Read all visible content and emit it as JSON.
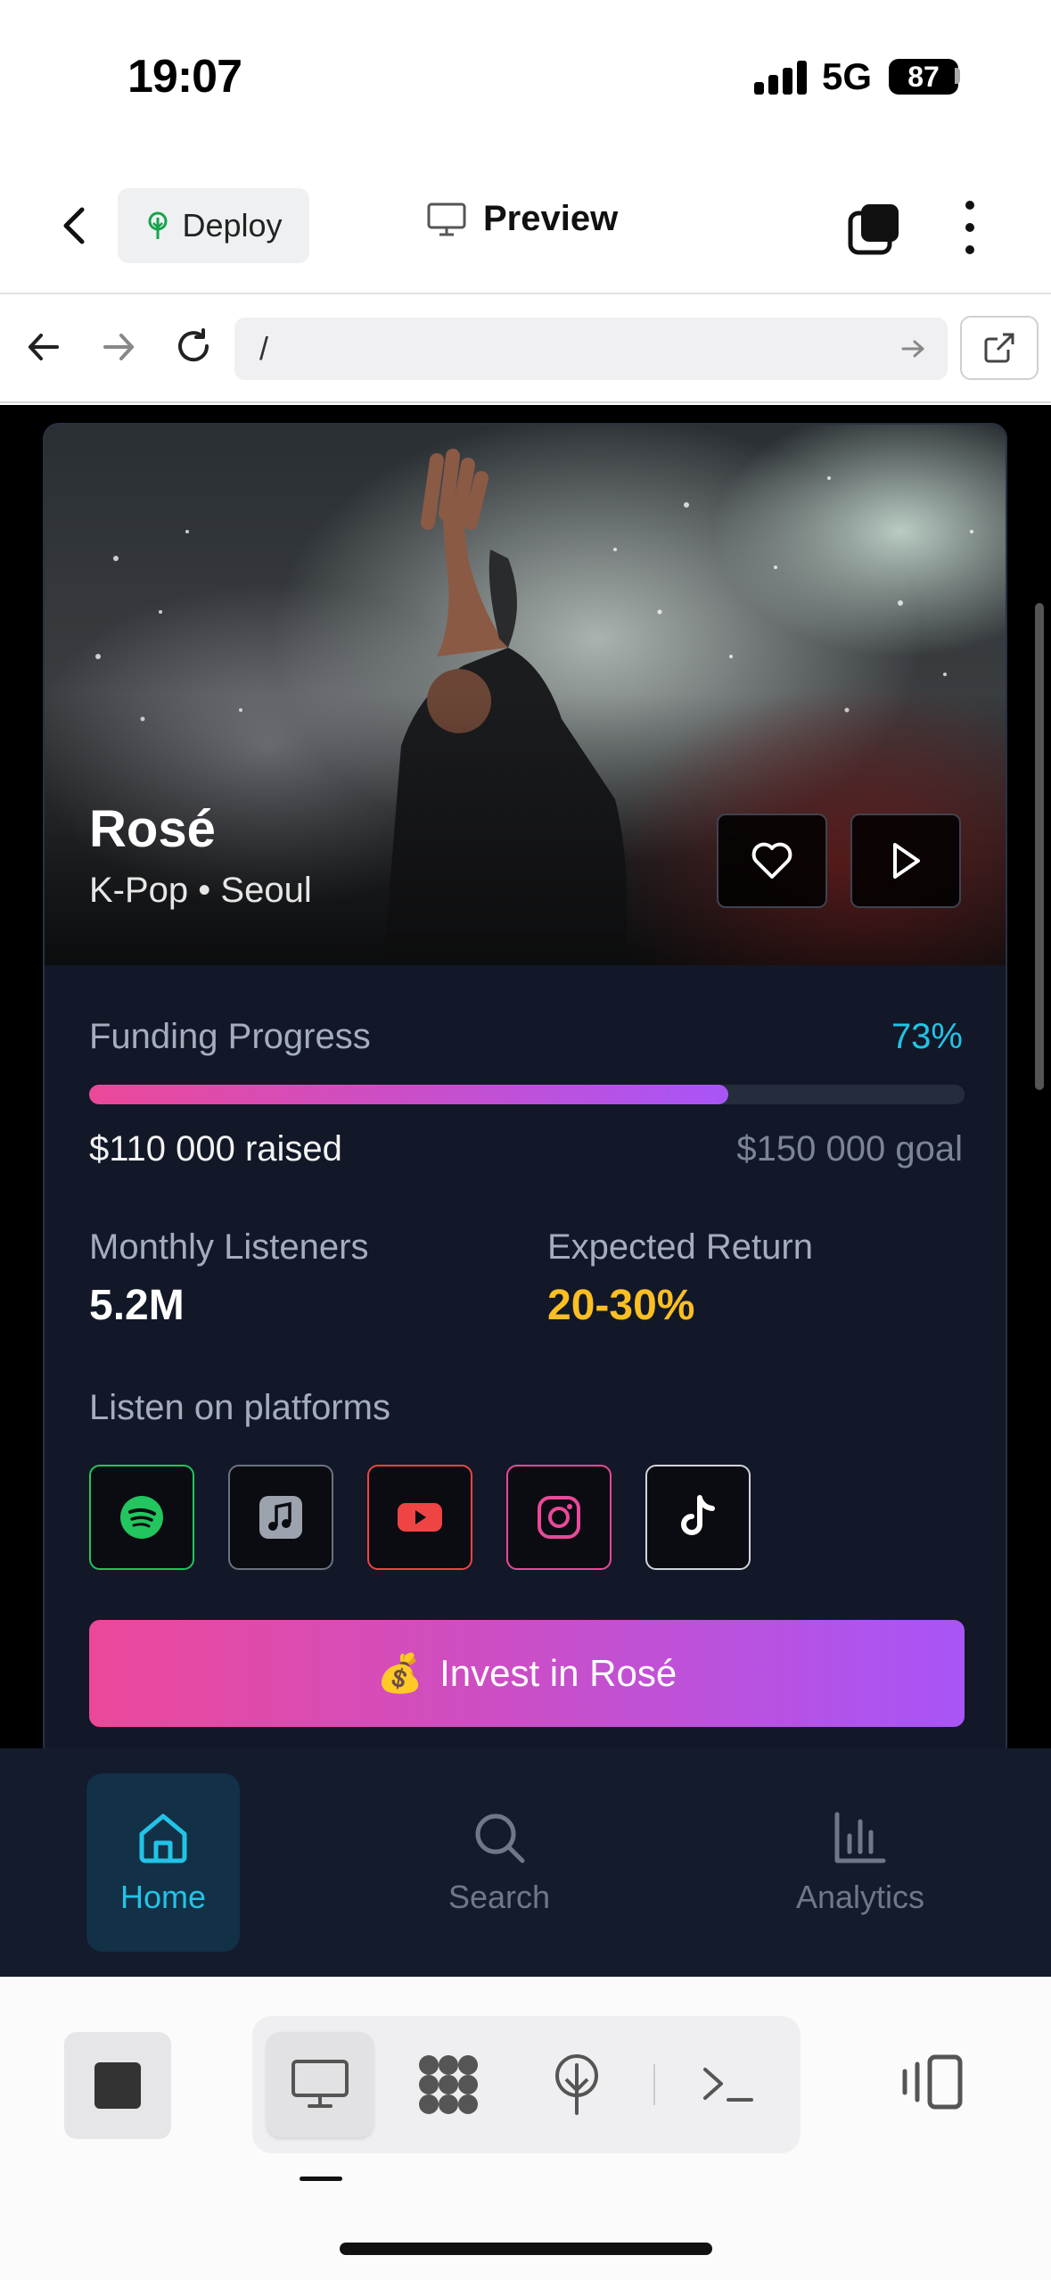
{
  "status_bar": {
    "time": "19:07",
    "network": "5G",
    "battery": "87"
  },
  "header": {
    "deploy_label": "Deploy",
    "preview_label": "Preview"
  },
  "url_bar": {
    "value": "/"
  },
  "artist": {
    "name": "Rosé",
    "meta": "K-Pop • Seoul"
  },
  "funding": {
    "label": "Funding Progress",
    "percent_text": "73%",
    "progress": 0.73,
    "raised_text": "$110 000 raised",
    "goal_text": "$150 000 goal"
  },
  "stats": {
    "listeners_label": "Monthly Listeners",
    "listeners_value": "5.2M",
    "return_label": "Expected Return",
    "return_value": "20-30%"
  },
  "platforms": {
    "label": "Listen on platforms",
    "items": [
      {
        "name": "spotify",
        "color": "#22c55e"
      },
      {
        "name": "apple-music",
        "color": "#6b7280"
      },
      {
        "name": "youtube",
        "color": "#ef4444"
      },
      {
        "name": "instagram",
        "color": "#ec4899"
      },
      {
        "name": "tiktok",
        "color": "#d1d5db"
      }
    ]
  },
  "invest": {
    "emoji": "💰",
    "label": "Invest in Rosé"
  },
  "bottom_nav": {
    "items": [
      {
        "label": "Home",
        "active": true
      },
      {
        "label": "Search",
        "active": false
      },
      {
        "label": "Analytics",
        "active": false
      }
    ]
  },
  "colors": {
    "accent_cyan": "#22c3e6",
    "accent_pink": "#ec4899",
    "accent_purple": "#a855f7",
    "gold": "#fbbf24"
  }
}
